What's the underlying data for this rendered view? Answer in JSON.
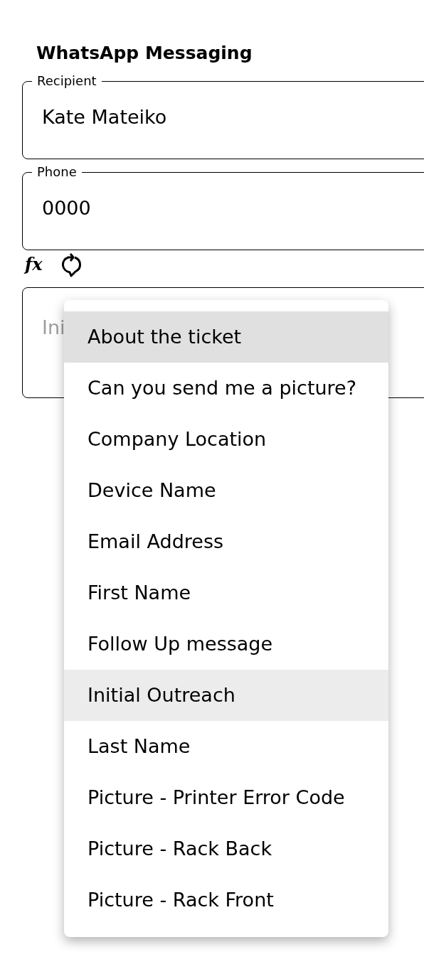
{
  "title": "WhatsApp Messaging",
  "fields": [
    {
      "label": "Recipient",
      "value": "Kate Mateiko"
    },
    {
      "label": "Phone",
      "value": "0000"
    }
  ],
  "toolbar": {
    "formula": "fx"
  },
  "message_field": {
    "placeholder": "Ini"
  },
  "menu": {
    "items": [
      {
        "label": "About the ticket",
        "focused": true,
        "selected": false
      },
      {
        "label": "Can you send me a picture?",
        "focused": false,
        "selected": false
      },
      {
        "label": "Company Location",
        "focused": false,
        "selected": false
      },
      {
        "label": "Device Name",
        "focused": false,
        "selected": false
      },
      {
        "label": "Email Address",
        "focused": false,
        "selected": false
      },
      {
        "label": "First Name",
        "focused": false,
        "selected": false
      },
      {
        "label": "Follow Up message",
        "focused": false,
        "selected": false
      },
      {
        "label": "Initial Outreach",
        "focused": false,
        "selected": true
      },
      {
        "label": "Last Name",
        "focused": false,
        "selected": false
      },
      {
        "label": "Picture - Printer Error Code",
        "focused": false,
        "selected": false
      },
      {
        "label": "Picture - Rack Back",
        "focused": false,
        "selected": false
      },
      {
        "label": "Picture - Rack Front",
        "focused": false,
        "selected": false
      }
    ]
  }
}
